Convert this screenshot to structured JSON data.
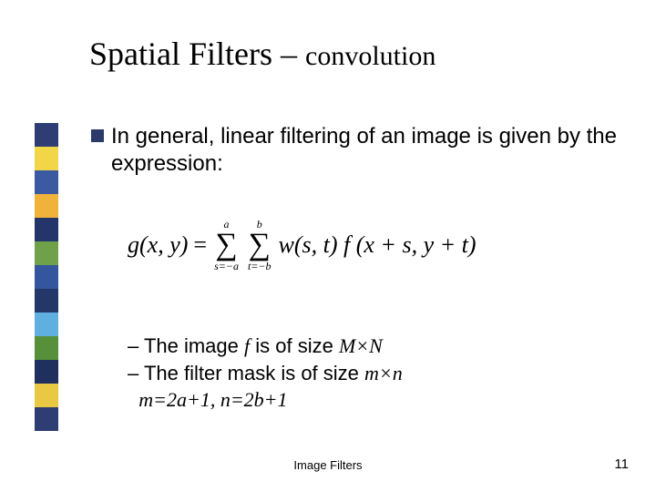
{
  "title": {
    "main": "Spatial Filters",
    "dash": "–",
    "sub": "convolution"
  },
  "bullet": {
    "text": "In general, linear filtering of an image is given by the expression:"
  },
  "formula": {
    "lhs": "g(x, y)",
    "eq": "=",
    "sum1_top": "a",
    "sum1_bot": "s=−a",
    "sum2_top": "b",
    "sum2_bot": "t=−b",
    "rhs": "w(s, t) f (x + s, y + t)"
  },
  "sub": {
    "line1_prefix": "– The image ",
    "line1_f": "f",
    "line1_mid": " is of size ",
    "line1_mn": "M×N",
    "line2_prefix": "– The filter mask is of size ",
    "line2_mn": "m×n",
    "line3_indent": "  ",
    "line3_eq": "m=2a+1, n=2b+1"
  },
  "footer": {
    "center": "Image Filters",
    "page": "11"
  },
  "sidebar_colors": [
    "#2e3d73",
    "#f2d648",
    "#3b5aa2",
    "#f0b23a",
    "#24356b",
    "#6fa04a",
    "#34569e",
    "#233768",
    "#5fb0e0",
    "#57903a",
    "#1f2f5e",
    "#e9c943",
    "#2e3d73"
  ]
}
